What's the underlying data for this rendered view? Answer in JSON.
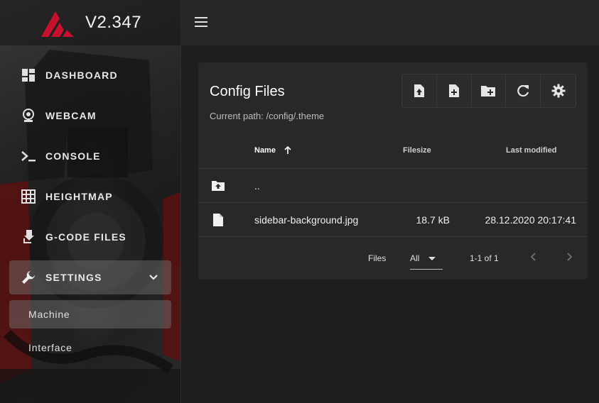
{
  "app": {
    "version": "V2.347",
    "brand_color": "#c8102e"
  },
  "sidebar": {
    "items": [
      {
        "label": "DASHBOARD",
        "icon": "dashboard-icon"
      },
      {
        "label": "WEBCAM",
        "icon": "webcam-icon"
      },
      {
        "label": "CONSOLE",
        "icon": "console-icon"
      },
      {
        "label": "HEIGHTMAP",
        "icon": "grid-icon"
      },
      {
        "label": "G-CODE FILES",
        "icon": "file-download-icon"
      },
      {
        "label": "SETTINGS",
        "icon": "wrench-icon",
        "active": true,
        "expanded": true
      }
    ],
    "sub_items": [
      {
        "label": "Machine",
        "active": true
      },
      {
        "label": "Interface",
        "active": false
      }
    ]
  },
  "topbar": {
    "menu_icon": "hamburger-icon"
  },
  "card": {
    "title": "Config Files",
    "path": "Current path: /config/.theme",
    "toolbar": [
      "upload-file-icon",
      "add-file-icon",
      "add-folder-icon",
      "refresh-icon",
      "gear-icon"
    ],
    "columns": {
      "name": "Name",
      "size": "Filesize",
      "modified": "Last modified"
    },
    "rows": [
      {
        "name": "..",
        "size": "",
        "modified": "",
        "icon": "folder-up-icon"
      },
      {
        "name": "sidebar-background.jpg",
        "size": "18.7 kB",
        "modified": "28.12.2020 20:17:41",
        "icon": "file-icon"
      }
    ],
    "footer": {
      "per_page_label": "Files",
      "per_page_value": "All",
      "range": "1-1 of 1"
    }
  }
}
